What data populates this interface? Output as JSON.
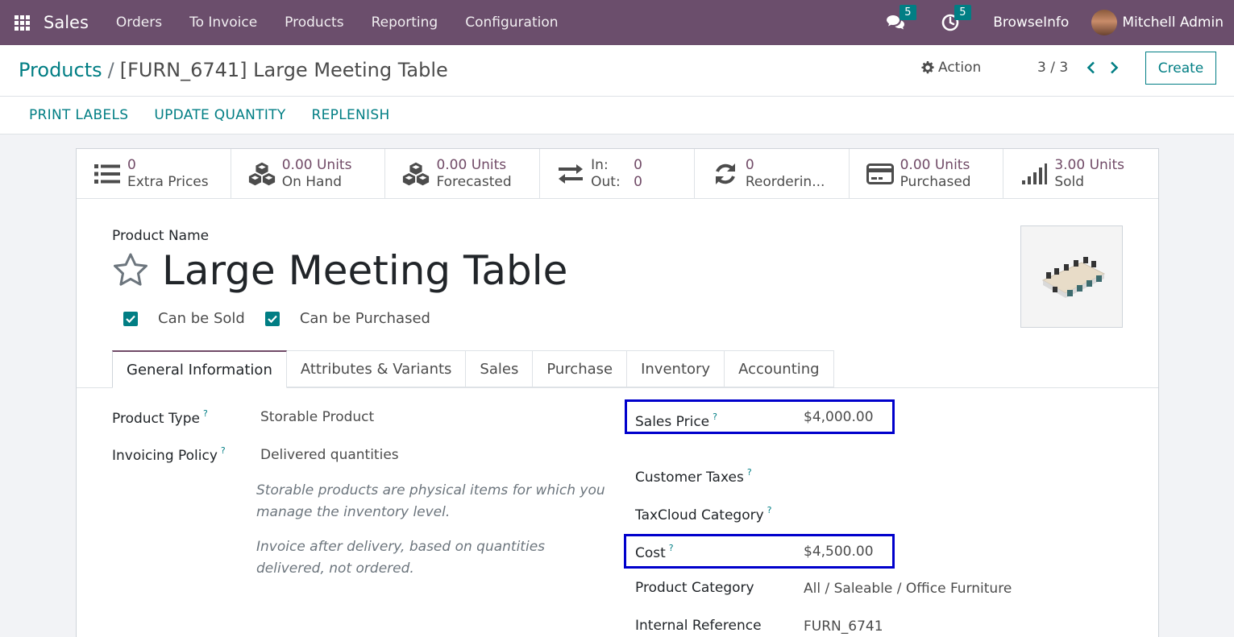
{
  "navbar": {
    "app_name": "Sales",
    "menu": [
      "Orders",
      "To Invoice",
      "Products",
      "Reporting",
      "Configuration"
    ],
    "messages_count": "5",
    "activities_count": "5",
    "company": "BrowseInfo",
    "user": "Mitchell Admin",
    "bg_color": "#6b4e6c"
  },
  "breadcrumb": {
    "parent": "Products",
    "separator": "/",
    "current": "[FURN_6741] Large Meeting Table"
  },
  "control": {
    "action_label": "Action",
    "pager": "3 / 3",
    "create_label": "Create"
  },
  "header_buttons": [
    "PRINT LABELS",
    "UPDATE QUANTITY",
    "REPLENISH"
  ],
  "stat_buttons": [
    {
      "icon": "list-icon",
      "value": "0",
      "label": "Extra Prices"
    },
    {
      "icon": "cubes-icon",
      "value": "0.00 Units",
      "label": "On Hand"
    },
    {
      "icon": "cubes-icon",
      "value": "0.00 Units",
      "label": "Forecasted"
    },
    {
      "icon": "exchange-icon",
      "in_label": "In:",
      "in_value": "0",
      "out_label": "Out:",
      "out_value": "0"
    },
    {
      "icon": "refresh-icon",
      "value": "0",
      "label": "Reorderin..."
    },
    {
      "icon": "credit-card-icon",
      "value": "0.00 Units",
      "label": "Purchased"
    },
    {
      "icon": "signal-icon",
      "value": "3.00 Units",
      "label": "Sold"
    }
  ],
  "product": {
    "name_label": "Product Name",
    "name": "Large Meeting Table",
    "can_be_sold_label": "Can be Sold",
    "can_be_sold": true,
    "can_be_purchased_label": "Can be Purchased",
    "can_be_purchased": true
  },
  "tabs": [
    "General Information",
    "Attributes & Variants",
    "Sales",
    "Purchase",
    "Inventory",
    "Accounting"
  ],
  "active_tab": "General Information",
  "fields_left": {
    "product_type_label": "Product Type",
    "product_type": "Storable Product",
    "invoicing_policy_label": "Invoicing Policy",
    "invoicing_policy": "Delivered quantities",
    "help_storable": "Storable products are physical items for which you manage the inventory level.",
    "help_invoice": "Invoice after delivery, based on quantities delivered, not ordered."
  },
  "fields_right": {
    "sales_price_label": "Sales Price",
    "sales_price": "$4,000.00",
    "customer_taxes_label": "Customer Taxes",
    "taxcloud_label": "TaxCloud Category",
    "cost_label": "Cost",
    "cost": "$4,500.00",
    "category_label": "Product Category",
    "category": "All / Saleable / Office Furniture",
    "internal_ref_label": "Internal Reference",
    "internal_ref": "FURN_6741"
  },
  "help_marker": "?",
  "colors": {
    "accent": "#017e84",
    "primary": "#714b67",
    "highlight_box": "#0000cc"
  }
}
